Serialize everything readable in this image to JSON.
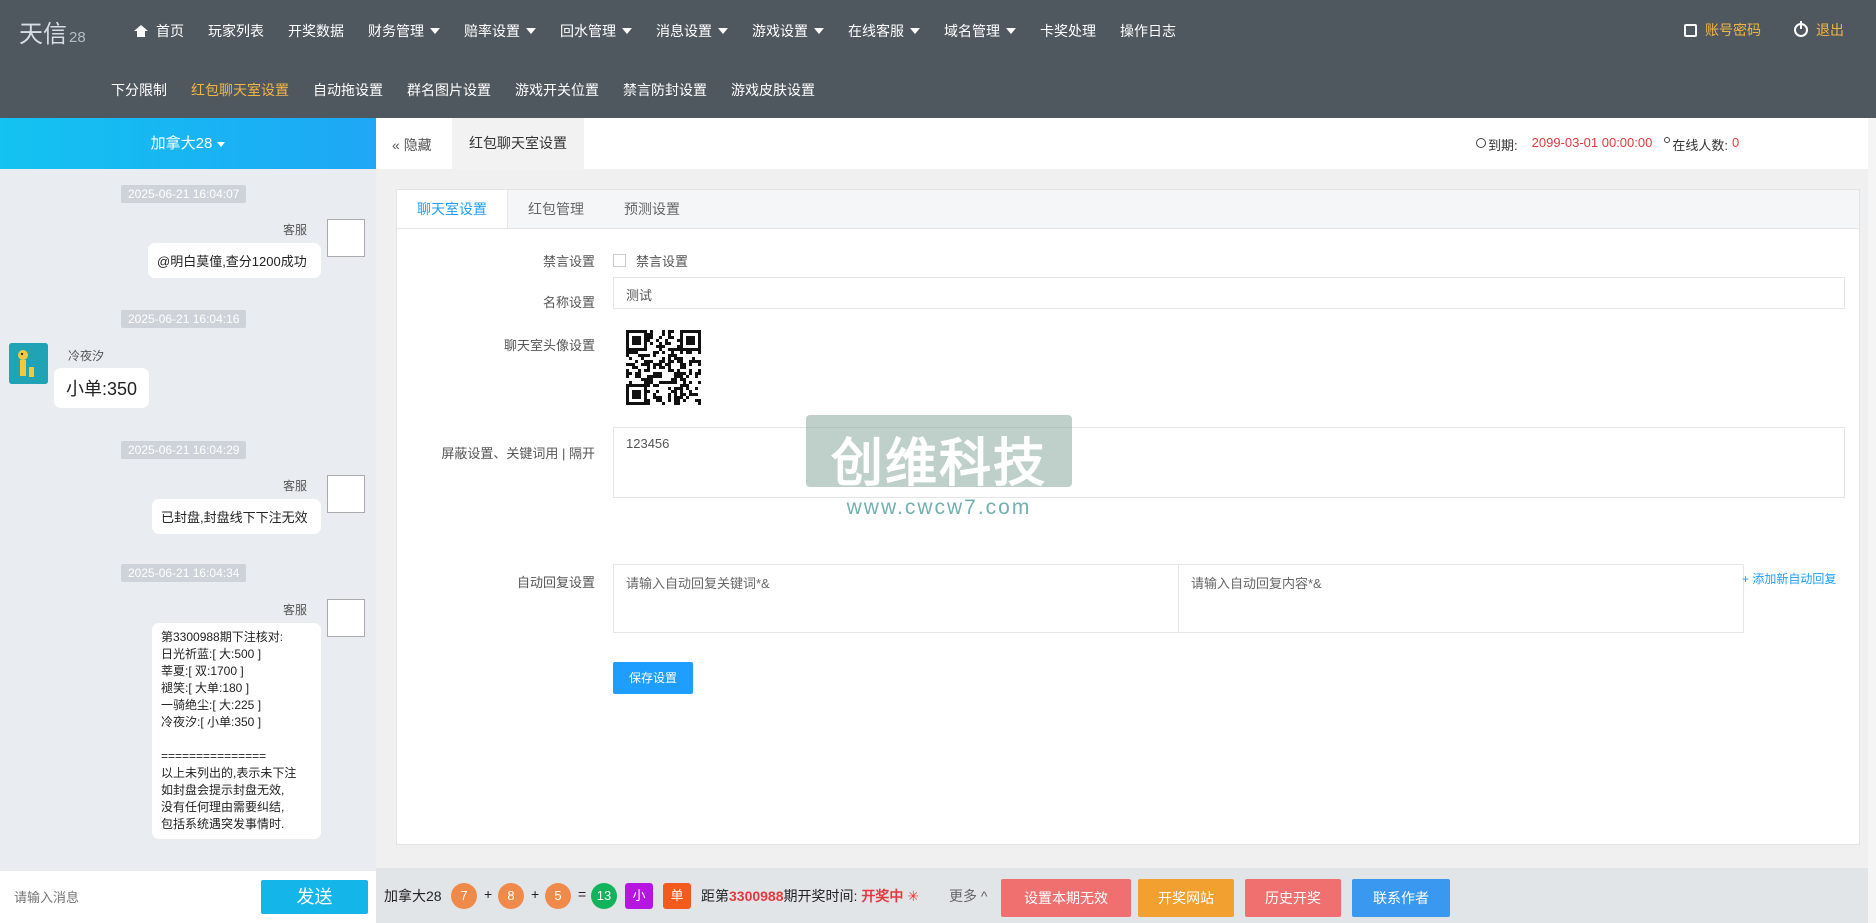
{
  "app": {
    "logo": "天信",
    "logo_suffix": "28"
  },
  "nav_primary": [
    {
      "label": "首页",
      "icon": "home-icon"
    },
    {
      "label": "玩家列表"
    },
    {
      "label": "开奖数据"
    },
    {
      "label": "财务管理",
      "dropdown": true
    },
    {
      "label": "赔率设置",
      "dropdown": true
    },
    {
      "label": "回水管理",
      "dropdown": true
    },
    {
      "label": "消息设置",
      "dropdown": true
    },
    {
      "label": "游戏设置",
      "dropdown": true
    },
    {
      "label": "在线客服",
      "dropdown": true
    },
    {
      "label": "域名管理",
      "dropdown": true
    },
    {
      "label": "卡奖处理"
    },
    {
      "label": "操作日志"
    }
  ],
  "nav_right": {
    "account_label": "账号密码",
    "logout_label": "退出"
  },
  "nav_secondary": [
    {
      "label": "下分限制"
    },
    {
      "label": "红包聊天室设置",
      "active": true
    },
    {
      "label": "自动拖设置"
    },
    {
      "label": "群名图片设置"
    },
    {
      "label": "游戏开关位置"
    },
    {
      "label": "禁言防封设置"
    },
    {
      "label": "游戏皮肤设置"
    }
  ],
  "chat": {
    "room": "加拿大28",
    "messages": [
      {
        "time": "2025-06-21 16:04:07",
        "sender": "客服",
        "text": "@明白莫僮,查分1200成功"
      },
      {
        "time": "2025-06-21 16:04:16",
        "sender": "冷夜汐",
        "text": "小单:350"
      },
      {
        "time": "2025-06-21 16:04:29",
        "sender": "客服",
        "text": "已封盘,封盘线下下注无效"
      },
      {
        "time": "2025-06-21 16:04:34",
        "sender": "客服",
        "lines": [
          "第3300988期下注核对:",
          "日光祈蓝:[ 大:500 ]",
          "莘夏:[ 双:1700 ]",
          "褪笑:[ 大单:180 ]",
          "一骑绝尘:[ 大:225 ]",
          "冷夜汐:[ 小单:350 ]",
          "",
          "===============",
          "以上未列出的,表示未下注",
          "如封盘会提示封盘无效,",
          "没有任何理由需要纠结,",
          "包括系统遇突发事情时."
        ]
      }
    ],
    "input_placeholder": "请输入消息",
    "send_label": "发送"
  },
  "tabbar": {
    "hide_label": "隐藏",
    "current_tab": "红包聊天室设置",
    "expire_label": "到期:",
    "expire_value": "2099-03-01 00:00:00",
    "online_label": "在线人数:",
    "online_value": "0"
  },
  "settings": {
    "tabs": [
      {
        "label": "聊天室设置",
        "active": true
      },
      {
        "label": "红包管理"
      },
      {
        "label": "预测设置"
      }
    ],
    "mute_label": "禁言设置",
    "mute_checkbox_label": "禁言设置",
    "name_label": "名称设置",
    "name_value": "测试",
    "avatar_label": "聊天室头像设置",
    "block_label": "屏蔽设置、关键词用 | 隔开",
    "block_value": "123456",
    "autoreply_label": "自动回复设置",
    "autoreply_key_placeholder": "请输入自动回复关键词*&",
    "autoreply_content_placeholder": "请输入自动回复内容*&",
    "add_autoreply_label": "+ 添加新自动回复",
    "save_label": "保存设置"
  },
  "watermark": {
    "text": "创维科技",
    "url": "www.cwcw7.com"
  },
  "footer": {
    "game": "加拿大28",
    "balls": [
      "7",
      "8",
      "5"
    ],
    "sum": "13",
    "tag1": "小",
    "tag2": "单",
    "period_prefix": "距第",
    "period": "3300988",
    "period_suffix": "期开奖时间:",
    "status": "开奖中",
    "more_label": "更多",
    "buttons": [
      "设置本期无效",
      "开奖网站",
      "历史开奖",
      "联系作者"
    ]
  },
  "colors": {
    "topbar": "#50585f",
    "accent": "#1e9fff",
    "highlight": "#f2b544",
    "red": "#e4393c"
  }
}
